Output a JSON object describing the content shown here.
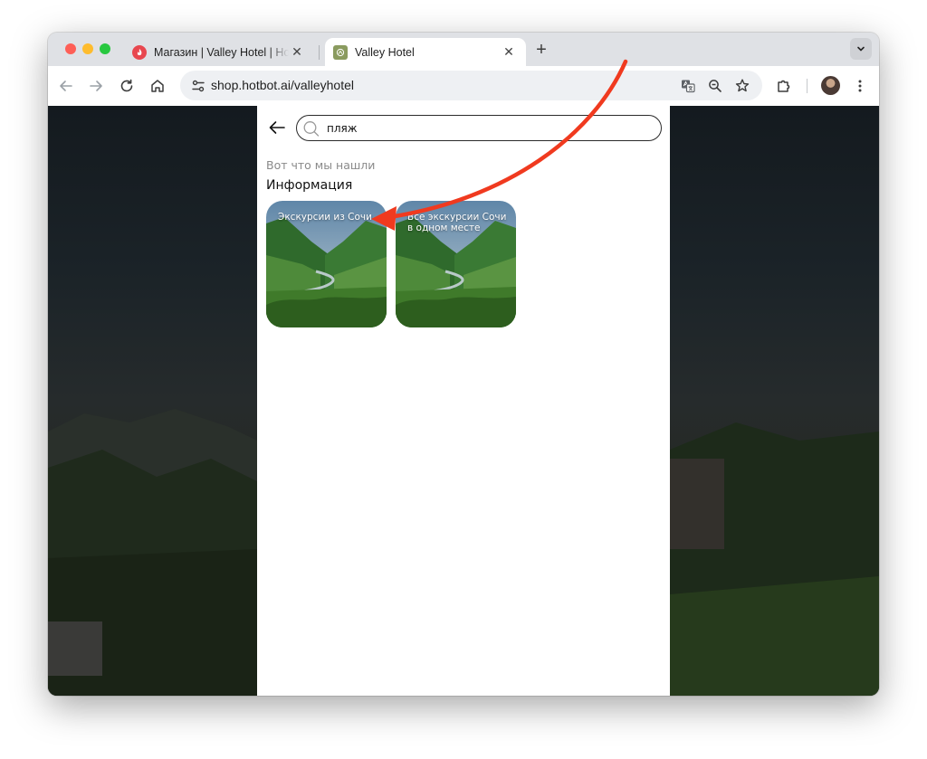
{
  "browser": {
    "tabs": [
      {
        "title": "Магазин | Valley Hotel | Hotbot",
        "active": false,
        "favicon": "hotbot-flame-icon"
      },
      {
        "title": "Valley Hotel",
        "active": true,
        "favicon": "valley-hotel-logo-icon"
      }
    ],
    "close_glyph": "✕",
    "newtab_glyph": "+",
    "url": "shop.hotbot.ai/valleyhotel"
  },
  "page": {
    "search": {
      "value": "пляж",
      "placeholder": ""
    },
    "results_heading": "Вот что мы нашли",
    "section_title": "Информация",
    "cards": [
      {
        "title": "Экскурсии из Сочи"
      },
      {
        "title": "Все экскурсии Сочи в одном месте"
      }
    ]
  },
  "annotation": {
    "arrow_color": "#f03a1f"
  }
}
